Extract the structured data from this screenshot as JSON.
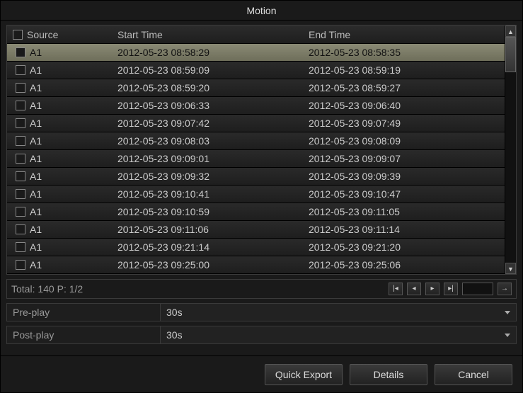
{
  "title": "Motion",
  "table": {
    "headers": {
      "source": "Source",
      "start": "Start Time",
      "end": "End Time"
    },
    "rows": [
      {
        "source": "A1",
        "start": "2012-05-23 08:58:29",
        "end": "2012-05-23 08:58:35",
        "selected": true
      },
      {
        "source": "A1",
        "start": "2012-05-23 08:59:09",
        "end": "2012-05-23 08:59:19"
      },
      {
        "source": "A1",
        "start": "2012-05-23 08:59:20",
        "end": "2012-05-23 08:59:27"
      },
      {
        "source": "A1",
        "start": "2012-05-23 09:06:33",
        "end": "2012-05-23 09:06:40"
      },
      {
        "source": "A1",
        "start": "2012-05-23 09:07:42",
        "end": "2012-05-23 09:07:49"
      },
      {
        "source": "A1",
        "start": "2012-05-23 09:08:03",
        "end": "2012-05-23 09:08:09"
      },
      {
        "source": "A1",
        "start": "2012-05-23 09:09:01",
        "end": "2012-05-23 09:09:07"
      },
      {
        "source": "A1",
        "start": "2012-05-23 09:09:32",
        "end": "2012-05-23 09:09:39"
      },
      {
        "source": "A1",
        "start": "2012-05-23 09:10:41",
        "end": "2012-05-23 09:10:47"
      },
      {
        "source": "A1",
        "start": "2012-05-23 09:10:59",
        "end": "2012-05-23 09:11:05"
      },
      {
        "source": "A1",
        "start": "2012-05-23 09:11:06",
        "end": "2012-05-23 09:11:14"
      },
      {
        "source": "A1",
        "start": "2012-05-23 09:21:14",
        "end": "2012-05-23 09:21:20"
      },
      {
        "source": "A1",
        "start": "2012-05-23 09:25:00",
        "end": "2012-05-23 09:25:06"
      }
    ]
  },
  "pager": {
    "status": "Total: 140  P: 1/2"
  },
  "settings": {
    "preplay_label": "Pre-play",
    "preplay_value": "30s",
    "postplay_label": "Post-play",
    "postplay_value": "30s"
  },
  "buttons": {
    "quick_export": "Quick Export",
    "details": "Details",
    "cancel": "Cancel"
  }
}
